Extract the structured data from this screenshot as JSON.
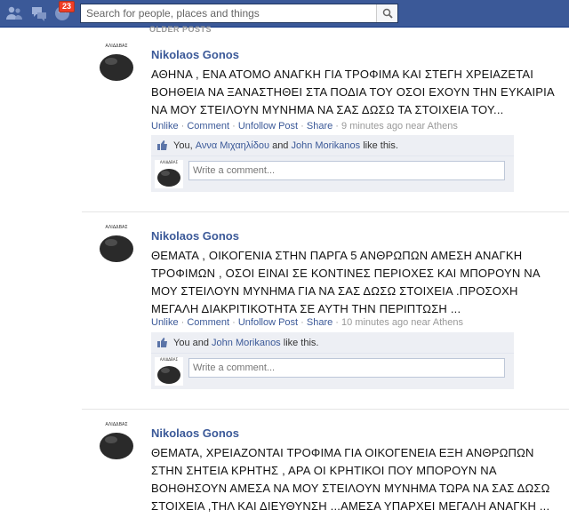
{
  "topbar": {
    "notification_count": "23",
    "search_placeholder": "Search for people, places and things"
  },
  "feed": {
    "older_label": "OLDER POSTS",
    "avatar_caption": "ΑΛΙΔΔΒΑΣ",
    "action_unlike": "Unlike",
    "action_comment": "Comment",
    "action_unfollow": "Unfollow Post",
    "action_share": "Share",
    "comment_placeholder": "Write a comment...",
    "posts": [
      {
        "author": "Nikolaos Gonos",
        "lines": [
          "ΑΘΗΝΑ , ΕΝΑ ΑΤΟΜΟ ΑΝΑΓΚΗ ΓΙΑ ΤΡΟΦΙΜΑ ΚΑΙ ΣΤΕΓΗ ΧΡΕΙΑΖΕΤΑΙ",
          "ΒΟΗΘΕΙΑ ΝΑ ΞΑΝΑΣΤΗΘΕΙ ΣΤΑ ΠΟΔΙΑ ΤΟΥ ΟΣΟΙ ΕΧΟΥΝ ΤΗΝ ΕΥΚΑΙΡΙΑ",
          "ΝΑ ΜΟΥ ΣΤΕΙΛΟΥΝ ΜΥΝΗΜΑ ΝΑ ΣΑΣ ΔΩΣΩ ΤΑ ΣΤΟΙΧΕΙΑ ΤΟΥ..."
        ],
        "time": "9 minutes ago near Athens",
        "likes_prefix": "You, ",
        "like_name_1": "Αννα Μιχαηλίδου",
        "likes_mid": " and ",
        "like_name_2": "John Morikanos",
        "likes_suffix": " like this."
      },
      {
        "author": "Nikolaos Gonos",
        "lines": [
          "ΘΕΜΑΤΑ , ΟΙΚΟΓΕΝΙΑ ΣΤΗΝ ΠΑΡΓΑ 5 ΑΝΘΡΩΠΩΝ ΑΜΕΣΗ ΑΝΑΓΚΗ",
          "ΤΡΟΦΙΜΩΝ , ΟΣΟΙ ΕΙΝΑΙ ΣΕ ΚΟΝΤΙΝΕΣ ΠΕΡΙΟΧΕΣ ΚΑΙ ΜΠΟΡΟΥΝ ΝΑ",
          "ΜΟΥ ΣΤΕΙΛΟΥΝ ΜΥΝΗΜΑ ΓΙΑ ΝΑ ΣΑΣ ΔΩΣΩ ΣΤΟΙΧΕΙΑ .ΠΡΟΣΟΧΗ",
          "ΜΕΓΑΛΗ ΔΙΑΚΡΙΤΙΚΟΤΗΤΑ ΣΕ ΑΥΤΗ ΤΗΝ ΠΕΡΙΠΤΩΣΗ ..."
        ],
        "time": "10 minutes ago near Athens",
        "likes_prefix": "You and ",
        "like_name_1": "John Morikanos",
        "likes_suffix": " like this."
      },
      {
        "author": "Nikolaos Gonos",
        "lines": [
          "ΘΕΜΑΤΑ, ΧΡΕΙΑΖΟΝΤΑΙ ΤΡΟΦΙΜΑ ΓΙΑ ΟΙΚΟΓΕΝΕΙΑ ΕΞΗ ΑΝΘΡΩΠΩΝ",
          "ΣΤΗΝ ΣΗΤΕΙΑ ΚΡΗΤΗΣ , ΑΡΑ ΟΙ ΚΡΗΤΙΚΟΙ ΠΟΥ ΜΠΟΡΟΥΝ ΝΑ",
          "ΒΟΗΘΗΣΟΥΝ ΑΜΕΣΑ ΝΑ ΜΟΥ ΣΤΕΙΛΟΥΝ ΜΥΝΗΜΑ ΤΩΡΑ ΝΑ ΣΑΣ ΔΩΣΩ",
          "ΣΤΟΙΧΕΙΑ ,ΤΗΛ ΚΑΙ ΔΙΕΥΘΥΝΣΗ ...ΑΜΕΣΑ ΥΠΑΡΧΕΙ ΜΕΓΑΛΗ ΑΝΑΓΚΗ ..."
        ]
      }
    ]
  },
  "colors": {
    "topbar": "#3b5998",
    "link": "#3b5998",
    "ufi_bg": "#edeff4",
    "badge": "#f03d25"
  },
  "icons": [
    "friends-icon",
    "messages-icon",
    "notifications-icon",
    "search-icon",
    "like-thumb-icon"
  ]
}
